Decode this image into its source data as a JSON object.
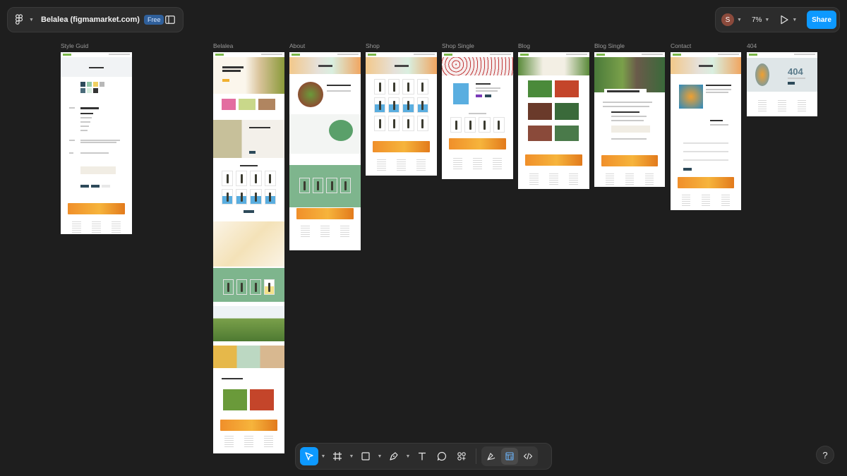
{
  "file": {
    "name": "Belalea (figmamarket.com)",
    "plan_badge": "Free"
  },
  "header_right": {
    "avatar_initial": "S",
    "zoom": "7%",
    "share_label": "Share"
  },
  "frames": [
    {
      "label": "Style Guid"
    },
    {
      "label": "Belalea"
    },
    {
      "label": "About"
    },
    {
      "label": "Shop"
    },
    {
      "label": "Shop Single"
    },
    {
      "label": "Blog"
    },
    {
      "label": "Blog Single"
    },
    {
      "label": "Contact"
    },
    {
      "label": "404"
    }
  ],
  "frame_404_text": "404",
  "toolbar": {
    "tools": [
      "move-tool",
      "frame-tool",
      "shape-tool",
      "pen-tool",
      "text-tool",
      "comment-tool",
      "actions-tool"
    ],
    "modes": [
      "draw-mode",
      "design-mode",
      "dev-mode"
    ]
  },
  "help_label": "?",
  "colors": {
    "canvas": "#1e1e1e",
    "panel": "#2c2c2c",
    "accent": "#0d99ff",
    "brand_green": "#7ab648",
    "banner_orange": "#f08f2a"
  }
}
